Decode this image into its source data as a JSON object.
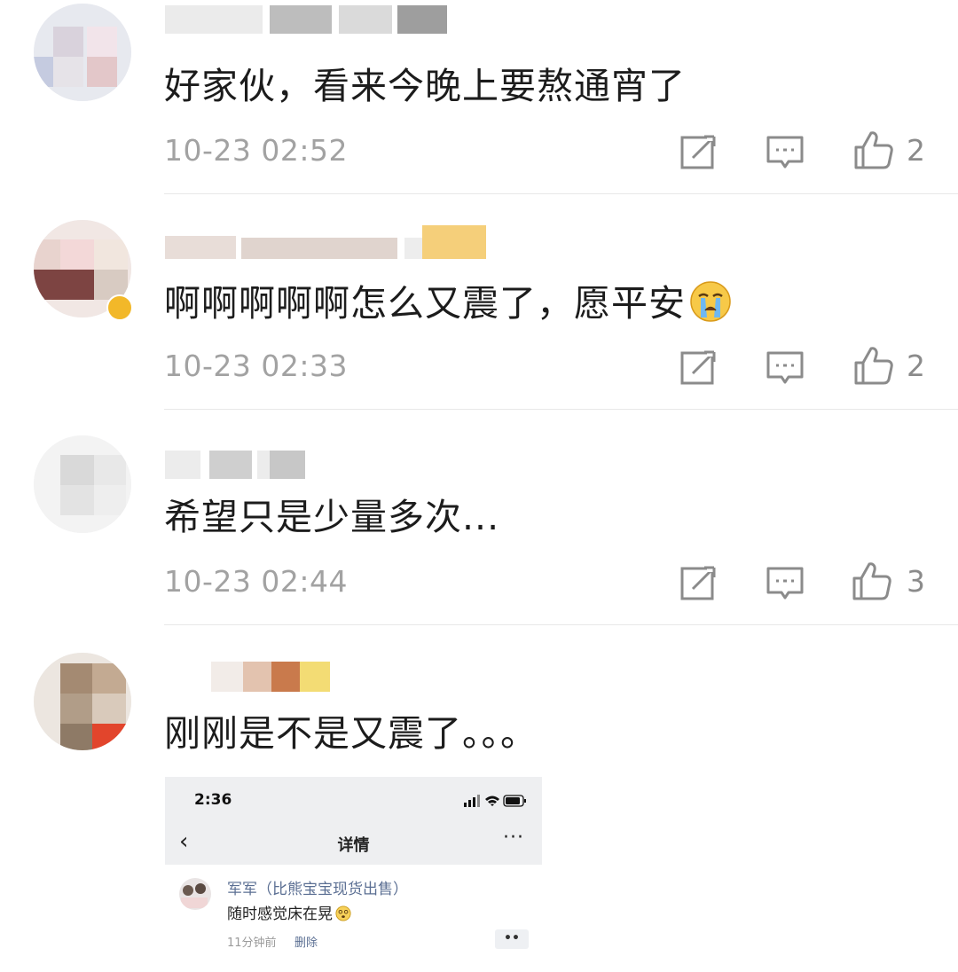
{
  "comments": [
    {
      "text": "好家伙，看来今晚上要熬通宵了",
      "time": "10-23 02:52",
      "likes": "2"
    },
    {
      "text": "啊啊啊啊啊怎么又震了，愿平安",
      "emoji": "crying-face-icon",
      "time": "10-23 02:33",
      "likes": "2"
    },
    {
      "text": "希望只是少量多次...",
      "time": "10-23 02:44",
      "likes": "3"
    },
    {
      "text": "刚刚是不是又震了。。。"
    }
  ],
  "icons": {
    "share": "share-icon",
    "reply": "comment-icon",
    "like": "thumbs-up-icon"
  },
  "embedded_screenshot": {
    "clock": "2:36",
    "back": "‹",
    "title": "详情",
    "more": "···",
    "author": "军军（比熊宝宝现货出售）",
    "text": "随时感觉床在晃",
    "time": "11分钟前",
    "delete_label": "删除",
    "dots": "••"
  },
  "colors": {
    "text": "#1c1c1c",
    "meta": "#a2a2a2",
    "icon": "#8b8b8b",
    "divider": "#e8e8e8",
    "link": "#5b6f93"
  }
}
